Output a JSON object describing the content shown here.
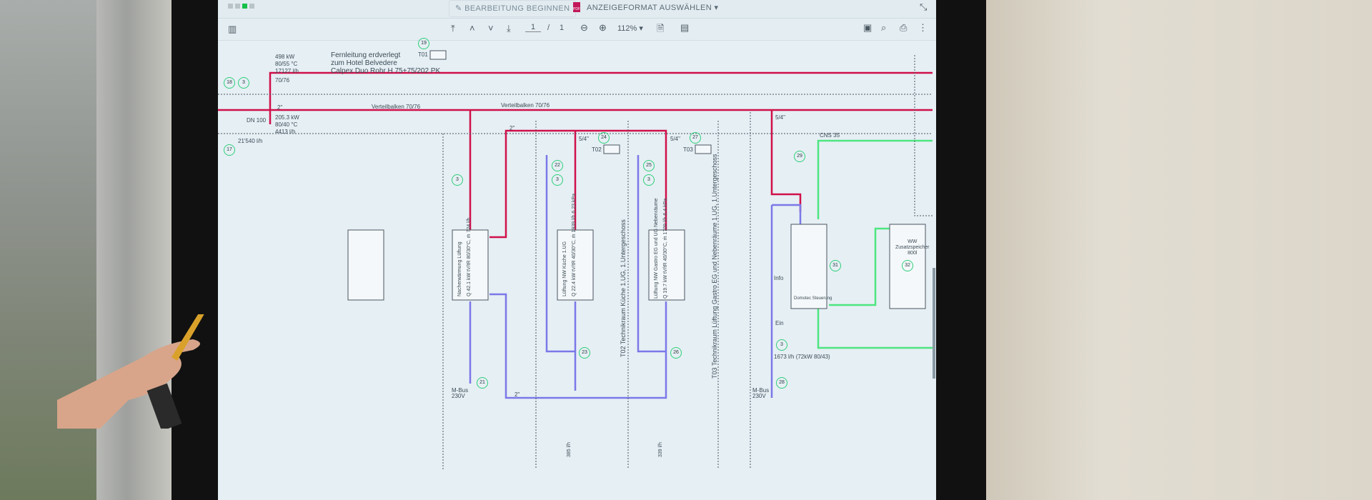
{
  "toolbar": {
    "edit_button": "BEARBEITUNG BEGINNEN",
    "pdf_icon": "pdf-icon",
    "display_format": "ANZEIGEFORMAT AUSWÄHLEN",
    "page_current": "1",
    "page_separator": "/",
    "page_total": "1",
    "zoom_level": "112%"
  },
  "colors": {
    "supply": "#d0104a",
    "return": "#7b78e8",
    "domestic": "#4de680",
    "badge": "#2fce7a"
  },
  "schematic": {
    "feed": {
      "power": "498 kW",
      "temp": "80/55 °C",
      "flow": "17127 l/h",
      "dim": "70/76"
    },
    "pipe_label": [
      "Fernleitung erdverlegt",
      "zum Hotel Belvedere",
      "Calpex Duo Rohr H 75+75/202 PK"
    ],
    "branch": {
      "size": "2\"",
      "power": "205.3 kW",
      "temp": "80/40 °C",
      "flow": "4413 l/h",
      "dn": "DN 100",
      "flow2": "21'540 l/h"
    },
    "manifold_left": "Verteilbalken 70/76",
    "manifold_right": "Verteilbalken 70/76",
    "sensors": [
      "T01",
      "T02",
      "T03"
    ],
    "badges": [
      "18",
      "3",
      "17",
      "19",
      "3",
      "24",
      "22",
      "3",
      "27",
      "25",
      "3",
      "29",
      "31",
      "32",
      "21",
      "23",
      "26",
      "28",
      "3"
    ],
    "size_small": "5/4\"",
    "size_2": "2\"",
    "units": [
      "Nacherwärmung Lüftung",
      "Lüftung NW Küche 1.UG",
      "Lüftung NW Gastro EG und UG Nebenräume"
    ],
    "unit_specs": [
      "Q 42.1 kW  tV/tR 80/30°C, ṁ 724 l/h",
      "Q 22.4 kW  tV/tR 40/30°C, ṁ 1939 l/h  6.23 kPa",
      "Q 19.7 kW  tV/tR 40/30°C, ṁ 1709 l/h  6.4 kPa"
    ],
    "room_t02": "T02 Technikraum Küche 1.UG, 1.Untergeschoss",
    "room_t03": "T03 Technikraum Lüftung Gastro EG und Nebenräume 1.UG, 1.Untergeschoss",
    "flow_23": "385 l/h",
    "flow_26": "339 l/h",
    "cns": "CNS 35",
    "storage": [
      "WW",
      "Zusatzspeicher",
      "800l"
    ],
    "info": "Info",
    "ein": "Ein",
    "domotec": "Domotec Steuerung",
    "mbus": [
      "M-Bus",
      "230V"
    ],
    "flow_right": "1673 l/h (72kW 80/43)"
  }
}
